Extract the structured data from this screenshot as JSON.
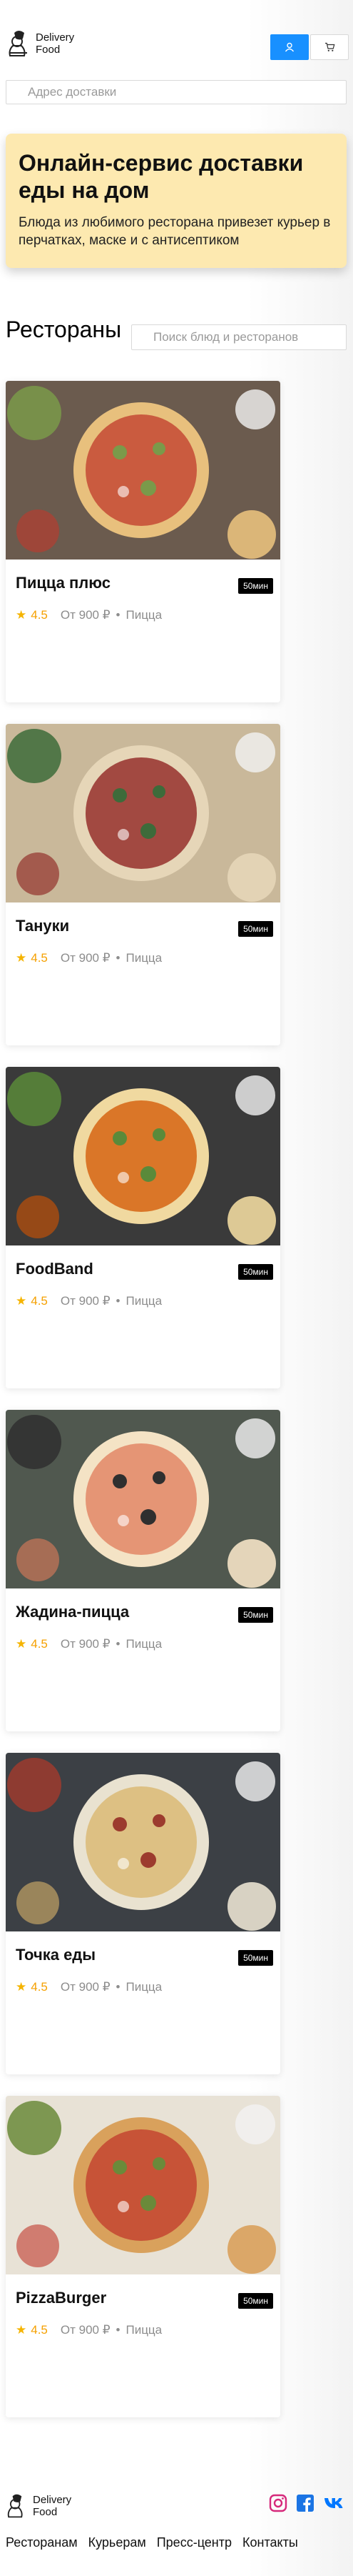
{
  "header": {
    "logo_line1": "Delivery",
    "logo_line2": "Food",
    "login_icon": "user-icon",
    "cart_icon": "cart-icon",
    "address_placeholder": "Адрес доставки"
  },
  "promo": {
    "title": "Онлайн-сервис доставки еды на дом",
    "text": "Блюда из любимого ресторана привезет курьер в перчатках, маске и с антисептиком"
  },
  "restaurants": {
    "title": "Рестораны",
    "search_placeholder": "Поиск блюд и ресторанов",
    "items": [
      {
        "name": "Пицца плюс",
        "time": "50мин",
        "rating": "4.5",
        "price": "От 900 ₽",
        "category": "Пицца"
      },
      {
        "name": "Тануки",
        "time": "50мин",
        "rating": "4.5",
        "price": "От 900 ₽",
        "category": "Пицца"
      },
      {
        "name": "FoodBand",
        "time": "50мин",
        "rating": "4.5",
        "price": "От 900 ₽",
        "category": "Пицца"
      },
      {
        "name": "Жадина-пицца",
        "time": "50мин",
        "rating": "4.5",
        "price": "От 900 ₽",
        "category": "Пицца"
      },
      {
        "name": "Точка еды",
        "time": "50мин",
        "rating": "4.5",
        "price": "От 900 ₽",
        "category": "Пицца"
      },
      {
        "name": "PizzaBurger",
        "time": "50мин",
        "rating": "4.5",
        "price": "От 900 ₽",
        "category": "Пицца"
      }
    ]
  },
  "footer": {
    "logo_line1": "Delivery",
    "logo_line2": "Food",
    "nav": [
      "Ресторанам",
      "Курьерам",
      "Пресс-центр",
      "Контакты"
    ],
    "social": [
      "instagram-icon",
      "facebook-icon",
      "vk-icon"
    ]
  },
  "colors": {
    "accent": "#1890ff",
    "promo_bg": "#fde9b0",
    "rating": "#f5a000"
  }
}
